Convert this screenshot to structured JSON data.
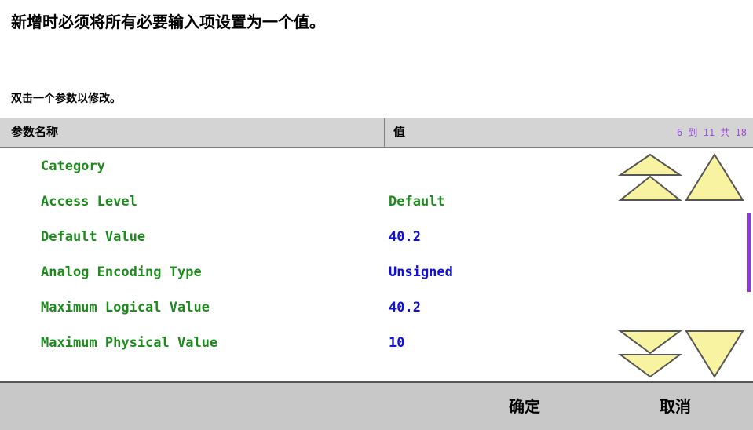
{
  "messages": {
    "header": "新增时必须将所有必要输入项设置为一个值。",
    "instruction": "双击一个参数以修改。"
  },
  "table": {
    "col_name": "参数名称",
    "col_value": "值",
    "pager": "6 到 11 共 18",
    "rows": [
      {
        "name": "Category",
        "value": ""
      },
      {
        "name": "Access Level",
        "value": "Default"
      },
      {
        "name": "Default Value",
        "value": "40.2"
      },
      {
        "name": "Analog Encoding Type",
        "value": "Unsigned"
      },
      {
        "name": "Maximum Logical Value",
        "value": "40.2"
      },
      {
        "name": "Maximum Physical Value",
        "value": "10"
      }
    ]
  },
  "footer": {
    "ok_label": "确定",
    "cancel_label": "取消"
  },
  "colors": {
    "name_text": "#1c8a1c",
    "value_set": "#1010d8",
    "scroll_arrow_fill": "#f7f3a0",
    "scroll_thumb": "#8a3cd6"
  }
}
